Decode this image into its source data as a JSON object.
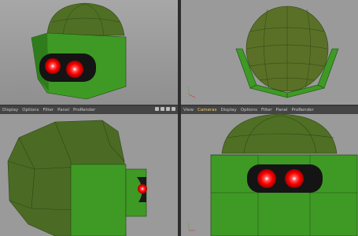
{
  "menu_left": {
    "items": [
      "Display",
      "Options",
      "Filter",
      "Panel",
      "ProRender"
    ]
  },
  "menu_right": {
    "items": [
      "View",
      "Cameras",
      "Display",
      "Options",
      "Filter",
      "Panel",
      "ProRender"
    ],
    "active": "Cameras"
  },
  "nav_icons": [
    "move-view-icon",
    "zoom-view-icon",
    "rotate-view-icon",
    "toggle-view-icon"
  ],
  "colors": {
    "helmet": "#4a7a26",
    "visor": "#3ea82a",
    "eyes": "#ff1010",
    "viewport_bg": "#9a9a9a"
  }
}
